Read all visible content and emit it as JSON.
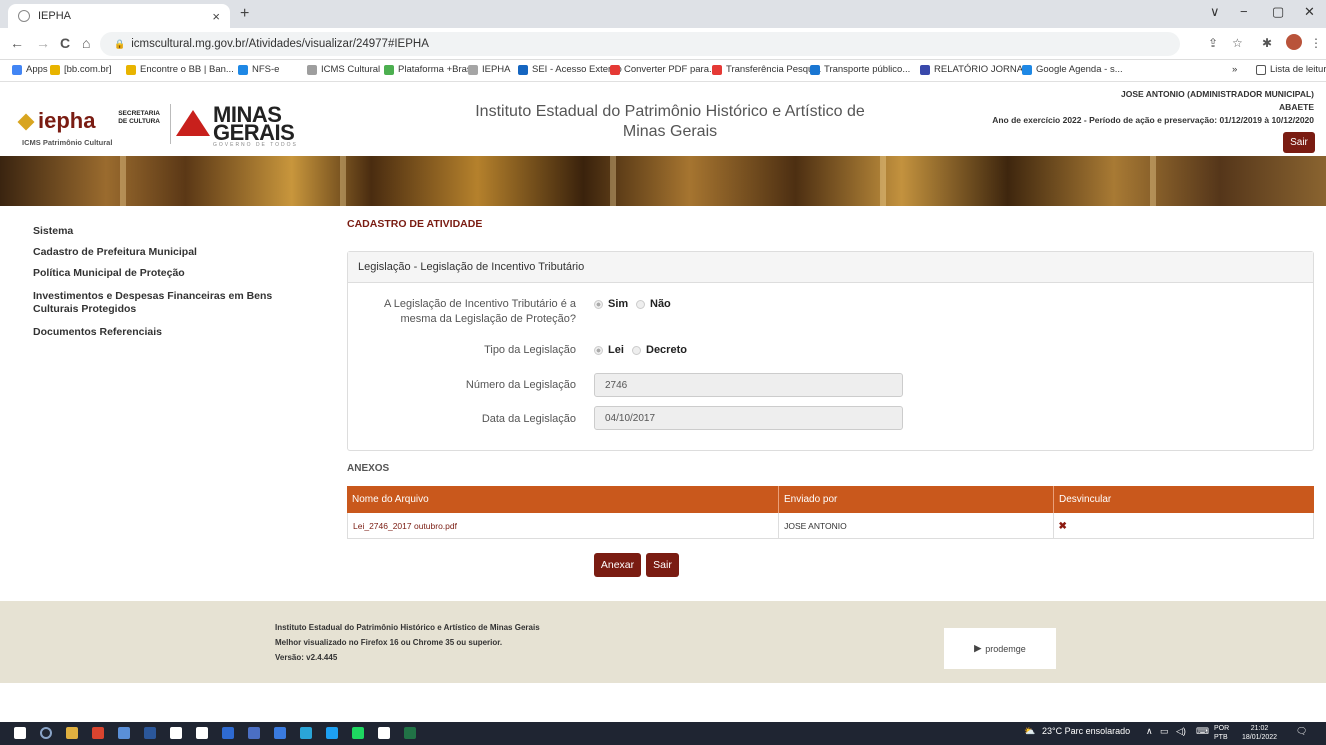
{
  "browser": {
    "tab_title": "IEPHA",
    "tab_close": "×",
    "new_tab": "+",
    "url": "icmscultural.mg.gov.br/Atividades/visualizar/24977#IEPHA",
    "window_controls": [
      "∨",
      "−",
      "▢",
      "✕"
    ],
    "nav": {
      "back": "←",
      "forward": "→",
      "reload": "C",
      "home": "⌂"
    },
    "bookmarks": [
      "Apps",
      "[bb.com.br]",
      "Encontre o BB | Ban...",
      "NFS-e",
      "ICMS Cultural",
      "Plataforma +Brasil",
      "IEPHA",
      "SEI - Acesso Externo",
      "Converter PDF para...",
      "Transferência Pesqu...",
      "Transporte público...",
      "RELATÓRIO JORNA...",
      "Google Agenda - s..."
    ],
    "bookmark_more": "»",
    "reading_list": "Lista de leitura",
    "bookmark_colors": [
      "#4285f4",
      "#e8b400",
      "#e8b400",
      "#1e88e5",
      "#9e9e9e",
      "#4caf50",
      "#a5a5a5",
      "#1565c0",
      "#e53935",
      "#e53935",
      "#1976d2",
      "#3949ab",
      "#1e88e5"
    ]
  },
  "header": {
    "logo_text": "iepha",
    "logo_subtitle": "ICMS Patrimônio Cultural",
    "secretaria": "SECRETARIA DE CULTURA",
    "mg_line1": "MINAS",
    "mg_line2": "GERAIS",
    "mg_gov": "GOVERNO DE TODOS",
    "title": "Instituto Estadual do Patrimônio Histórico e Artístico de Minas Gerais",
    "user": "JOSE ANTONIO  (ADMINISTRADOR MUNICIPAL)",
    "municipality": "ABAETE",
    "period": "Ano de exercício 2022 - Período de ação e preservação: 01/12/2019 à 10/12/2020",
    "logout": "Sair"
  },
  "sidebar": {
    "items": [
      "Sistema",
      "Cadastro de Prefeitura Municipal",
      "Política Municipal de Proteção",
      "Investimentos e Despesas Financeiras em Bens Culturais Protegidos",
      "Documentos Referenciais"
    ]
  },
  "main": {
    "page_title": "CADASTRO DE ATIVIDADE",
    "panel_title": "Legislação - Legislação de Incentivo Tributário",
    "q_same_label": "A Legislação de Incentivo Tributário é a mesma da Legislação de Proteção?",
    "opt_sim": "Sim",
    "opt_nao": "Não",
    "tipo_label": "Tipo da Legislação",
    "opt_lei": "Lei",
    "opt_decreto": "Decreto",
    "numero_label": "Número da Legislação",
    "numero_value": "2746",
    "data_label": "Data da Legislação",
    "data_value": "04/10/2017",
    "anexos_title": "ANEXOS",
    "table": {
      "headers": [
        "Nome do Arquivo",
        "Enviado por",
        "Desvincular"
      ],
      "rows": [
        {
          "file": "Lei_2746_2017 outubro.pdf",
          "sender": "JOSE ANTONIO",
          "remove": "✖"
        }
      ]
    },
    "btn_anexar": "Anexar",
    "btn_sair": "Sair"
  },
  "footer": {
    "line1": "Instituto Estadual do Patrimônio Histórico e Artístico de Minas Gerais",
    "line2": "Melhor visualizado no Firefox 16 ou Chrome 35 ou superior.",
    "line3": "Versão: v2.4.445",
    "partner": "prodemge"
  },
  "taskbar": {
    "weather": "23°C  Parc ensolarado",
    "lang_top": "POR",
    "lang_bottom": "PTB",
    "time": "21:02",
    "date": "18/01/2022",
    "app_colors": [
      "#ffffff",
      "#8aa4c8",
      "#e0b040",
      "#d9442f",
      "#5a8fd8",
      "#2b579a",
      "#ffffff",
      "#ffffff",
      "#2e6ad1",
      "#4b6fc4",
      "#3a7be0",
      "#2aa5d8",
      "#1da0f2",
      "#1ed760",
      "#ffffff",
      "#217346"
    ]
  }
}
